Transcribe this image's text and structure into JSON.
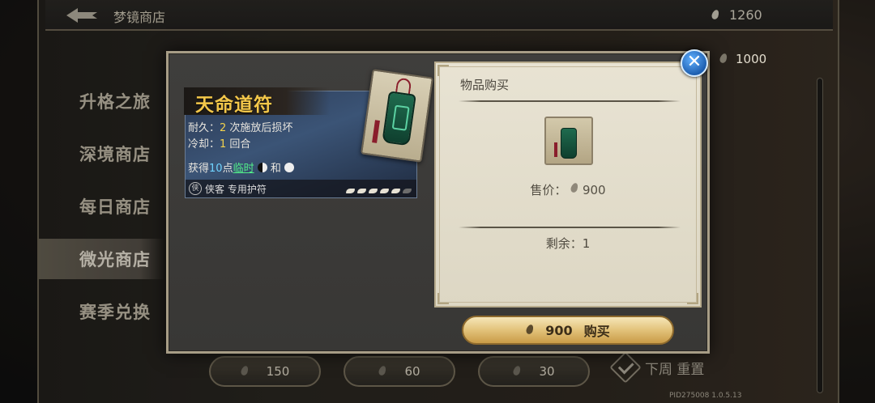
{
  "header": {
    "back_label": "",
    "title": "梦镜商店",
    "currency_main": "1260",
    "currency_secondary": "1000"
  },
  "sidebar": {
    "items": [
      {
        "label": "升格之旅"
      },
      {
        "label": "深境商店"
      },
      {
        "label": "每日商店"
      },
      {
        "label": "微光商店"
      },
      {
        "label": "赛季兑换"
      }
    ],
    "active_index": 3
  },
  "shop_bottom": {
    "prices": [
      "150",
      "60",
      "30"
    ],
    "reset_label": "下周 重置"
  },
  "version": "PID275008  1.0.5.13",
  "modal": {
    "card": {
      "title": "天命道符",
      "durability_label": "耐久：",
      "durability_value": "2",
      "durability_suffix": " 次施放后损坏",
      "cooldown_label": "冷却：",
      "cooldown_value": "1",
      "cooldown_suffix": " 回合",
      "gain_prefix": "获得",
      "gain_value": "10",
      "gain_unit": "点",
      "gain_effect": "临时",
      "gain_and": "和",
      "footer_text": "侠客 专用护符",
      "class_icon_glyph": "侠"
    },
    "panel": {
      "title": "物品购买",
      "price_label": "售价：",
      "price_value": "900",
      "remain_label": "剩余：",
      "remain_value": "1"
    },
    "buy_button": {
      "price": "900",
      "label": "购买"
    },
    "close_label": "✕"
  },
  "colors": {
    "accent_gold": "#f3c74a",
    "close_blue": "#1e5fb0",
    "highlight_green": "#52ef8a",
    "highlight_blue": "#6fd3ff"
  }
}
